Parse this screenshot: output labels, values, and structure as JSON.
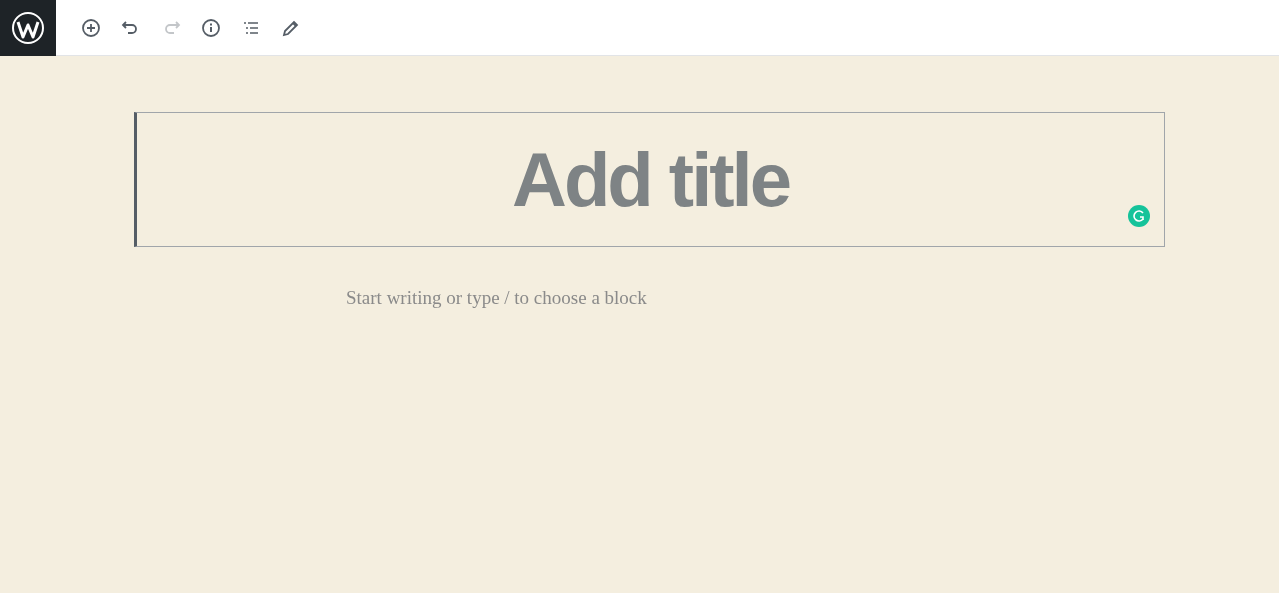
{
  "toolbar": {
    "buttons": [
      {
        "kind": "add",
        "disabled": false
      },
      {
        "kind": "undo",
        "disabled": false
      },
      {
        "kind": "redo",
        "disabled": true
      },
      {
        "kind": "info",
        "disabled": false
      },
      {
        "kind": "outline",
        "disabled": false
      },
      {
        "kind": "edit",
        "disabled": false
      }
    ]
  },
  "title": {
    "placeholder": "Add title",
    "selected": true
  },
  "body": {
    "placeholder": "Start writing or type / to choose a block"
  }
}
